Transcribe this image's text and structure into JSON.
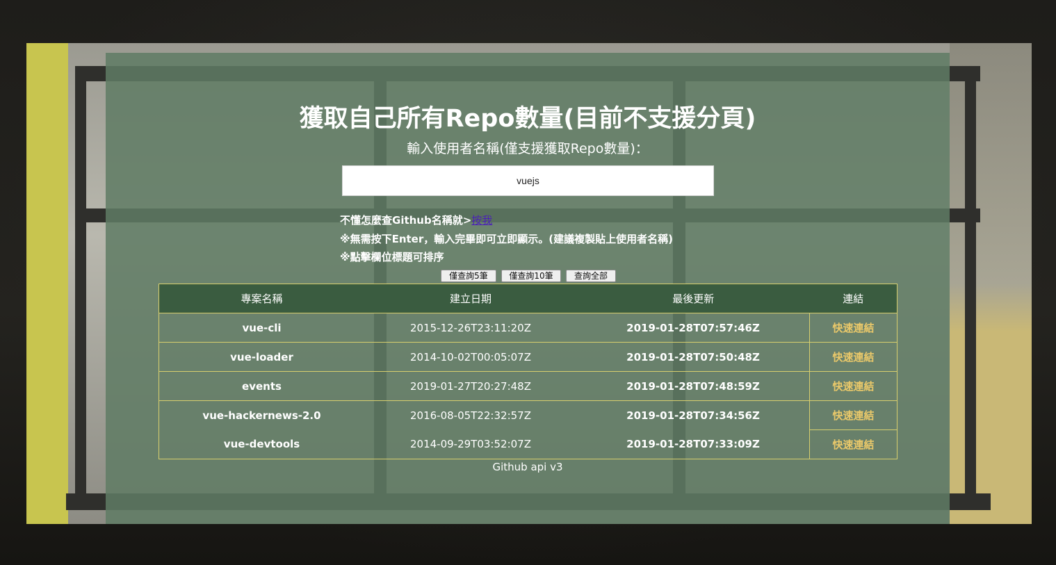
{
  "page": {
    "title": "獲取自己所有Repo數量(目前不支援分頁)",
    "subtitle": "輸入使用者名稱(僅支援獲取Repo數量)："
  },
  "search": {
    "value": "vuejs"
  },
  "notes": {
    "line1_prefix": "不懂怎麼查Github名稱就>",
    "line1_link": "按我",
    "line2": "※無需按下Enter，輸入完畢即可立即顯示。(建議複製貼上使用者名稱)",
    "line3": "※點擊欄位標題可排序"
  },
  "buttons": {
    "five": "僅查詢5筆",
    "ten": "僅查詢10筆",
    "all": "查詢全部"
  },
  "table": {
    "headers": {
      "name": "專案名稱",
      "created": "建立日期",
      "updated": "最後更新",
      "link": "連結"
    },
    "rows": [
      {
        "name": "vue-cli",
        "created": "2015-12-26T23:11:20Z",
        "updated": "2019-01-28T07:57:46Z",
        "link": "快速連結"
      },
      {
        "name": "vue-loader",
        "created": "2014-10-02T00:05:07Z",
        "updated": "2019-01-28T07:50:48Z",
        "link": "快速連結"
      },
      {
        "name": "events",
        "created": "2019-01-27T20:27:48Z",
        "updated": "2019-01-28T07:48:59Z",
        "link": "快速連結"
      },
      {
        "name": "vue-hackernews-2.0",
        "created": "2016-08-05T22:32:57Z",
        "updated": "2019-01-28T07:34:56Z",
        "link": "快速連結"
      },
      {
        "name": "vue-devtools",
        "created": "2014-09-29T03:52:07Z",
        "updated": "2019-01-28T07:33:09Z",
        "link": "快速連結"
      }
    ]
  },
  "footer": {
    "text": "Github api v3"
  },
  "colors": {
    "panel": "#607c64",
    "header_bg": "#3a5c40",
    "border": "#d8cf6e",
    "link": "#e9c86a"
  }
}
